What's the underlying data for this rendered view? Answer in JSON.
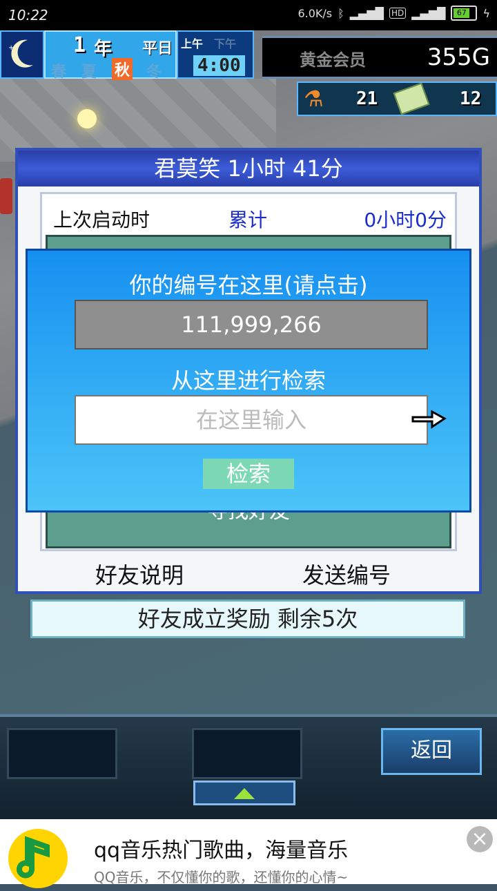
{
  "status_bar": {
    "time": "10:22",
    "network_speed": "6.0K/s",
    "battery": "67"
  },
  "hud": {
    "year_num": "1",
    "year_char": "年",
    "day_type": "平日",
    "seasons": [
      "春",
      "夏",
      "秋",
      "冬"
    ],
    "am_label": "上午",
    "pm_label": "下午",
    "clock": "4:00",
    "membership": "黄金会员",
    "gold": "355G",
    "flask_count": "21",
    "ticket_count": "12"
  },
  "dialog": {
    "title": "君莫笑  1小时 41分",
    "last_start_label": "上次启动时",
    "total_label": "累计",
    "total_value": "0小时0分",
    "find_friends": "寻找好友",
    "friend_help": "好友说明",
    "send_id": "发送编号"
  },
  "modal": {
    "id_prompt": "你的编号在这里(请点击)",
    "id_value": "111,999,266",
    "search_prompt": "从这里进行检索",
    "search_placeholder": "在这里输入",
    "search_button": "检索"
  },
  "reward": {
    "text": "好友成立奖励  剩余5次"
  },
  "bottom": {
    "back": "返回"
  },
  "ad": {
    "title": "qq音乐热门歌曲，海量音乐",
    "subtitle": "QQ音乐，不仅懂你的歌，还懂你的心情~",
    "close": "×"
  }
}
